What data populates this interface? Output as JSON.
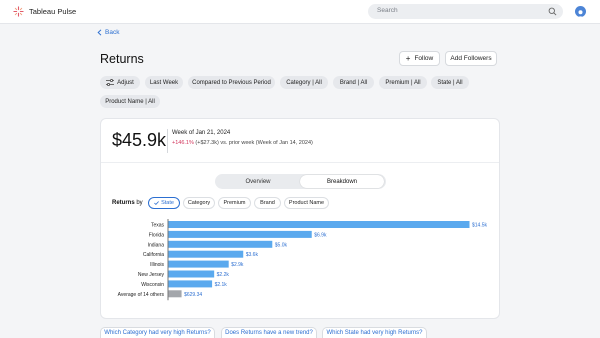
{
  "app": {
    "name": "Tableau Pulse"
  },
  "search": {
    "placeholder": "Search"
  },
  "nav": {
    "back_label": "Back"
  },
  "page": {
    "title": "Returns"
  },
  "actions": {
    "follow_label": "Follow",
    "add_followers_label": "Add Followers"
  },
  "filters": {
    "adjust_label": "Adjust",
    "chips": [
      "Last Week",
      "Compared to Previous Period",
      "Category  |  All",
      "Brand  |  All",
      "Premium  |  All",
      "State  |  All",
      "Product Name  |  All"
    ]
  },
  "metric": {
    "value": "$45.9k",
    "period": "Week of Jan 21, 2024",
    "change_pct": "+146.1%",
    "change_rest": " (+$27.3k) vs. prior week (Week of Jan 14, 2024)"
  },
  "tabs": {
    "overview": "Overview",
    "breakdown": "Breakdown"
  },
  "breakdown": {
    "label": "Returns",
    "by": " by",
    "dimensions": [
      "State",
      "Category",
      "Premium",
      "Brand",
      "Product Name"
    ],
    "selected": "State"
  },
  "chart_data": {
    "type": "bar",
    "orientation": "horizontal",
    "categories": [
      "Texas",
      "Florida",
      "Indiana",
      "California",
      "Illinois",
      "New Jersey",
      "Wisconsin",
      "Average of 14 others"
    ],
    "values": [
      14.5,
      6.9,
      5.0,
      3.6,
      2.9,
      2.2,
      2.1,
      0.62934
    ],
    "value_labels": [
      "$14.5k",
      "$6.9k",
      "$5.0k",
      "$3.6k",
      "$2.9k",
      "$2.2k",
      "$2.1k",
      "$629.34"
    ],
    "colors": {
      "bar": "#5aa9ee",
      "others": "#a3a6ab",
      "label": "#2c6fd1"
    }
  },
  "questions": [
    "Which Category had very high Returns?",
    "Does Returns have a new trend?",
    "Which State had very high Returns?"
  ],
  "colors": {
    "accent": "#2c6fd1",
    "negative_change": "#d1345b",
    "avatar": "#4c84d6"
  }
}
